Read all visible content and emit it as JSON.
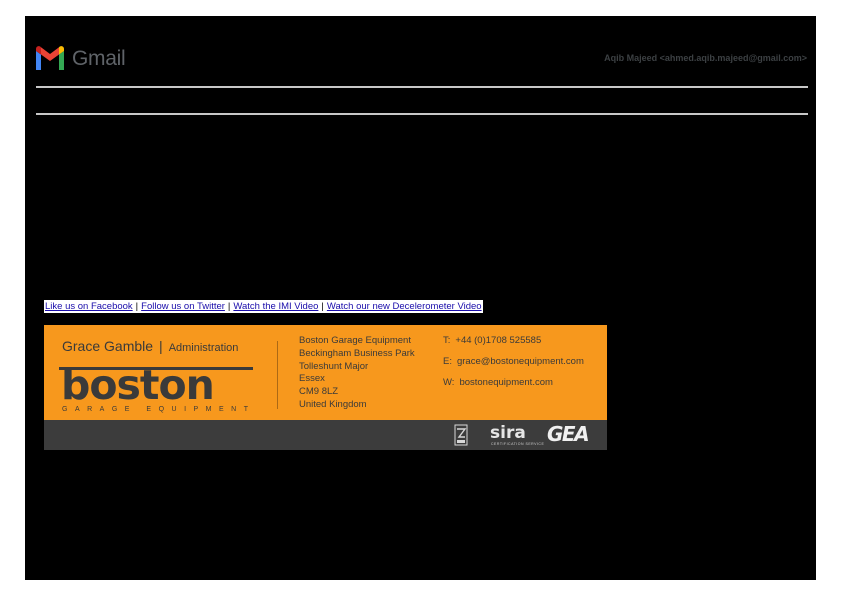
{
  "header": {
    "app_name": "Gmail",
    "account": "Aqib Majeed <ahmed.aqib.majeed@gmail.com>"
  },
  "footer_links": [
    "Like us on Facebook",
    "Follow us on Twitter",
    "Watch the IMI Video",
    "Watch our new Decelerometer Video"
  ],
  "signature": {
    "name": "Grace Gamble",
    "role": "Administration",
    "brand": "boston",
    "brand_sub": "GARAGE EQUIPMENT",
    "address": [
      "Boston Garage Equipment",
      "Beckingham Business Park",
      "Tolleshunt Major",
      "Essex",
      "CM9 8LZ",
      "United Kingdom"
    ],
    "contact": [
      {
        "key": "T:",
        "value": "+44 (0)1708 525585"
      },
      {
        "key": "E:",
        "value": "grace@bostonequipment.com"
      },
      {
        "key": "W:",
        "value": "bostonequipment.com"
      }
    ],
    "partner_logos": {
      "sira": "sira",
      "sira_sub": "CERTIFICATION SERVICE",
      "gea": "GEA"
    },
    "colors": {
      "accent": "#f7981d",
      "footer_band": "#3c3c3c"
    }
  }
}
